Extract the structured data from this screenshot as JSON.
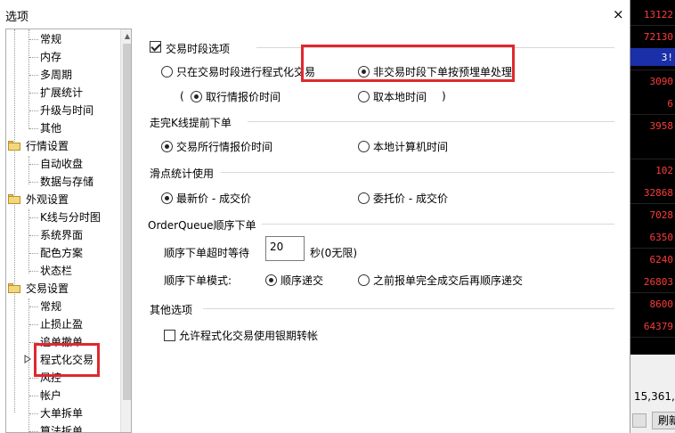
{
  "dialog": {
    "title": "选项",
    "close_label": "×"
  },
  "tree": {
    "items": [
      {
        "label": "常规",
        "type": "child"
      },
      {
        "label": "内存",
        "type": "child"
      },
      {
        "label": "多周期",
        "type": "child"
      },
      {
        "label": "扩展统计",
        "type": "child"
      },
      {
        "label": "升级与时间",
        "type": "child"
      },
      {
        "label": "其他",
        "type": "child"
      },
      {
        "label": "行情设置",
        "type": "group"
      },
      {
        "label": "自动收盘",
        "type": "child"
      },
      {
        "label": "数据与存储",
        "type": "child"
      },
      {
        "label": "外观设置",
        "type": "group"
      },
      {
        "label": "K线与分时图",
        "type": "child"
      },
      {
        "label": "系统界面",
        "type": "child"
      },
      {
        "label": "配色方案",
        "type": "child"
      },
      {
        "label": "状态栏",
        "type": "child"
      },
      {
        "label": "交易设置",
        "type": "group"
      },
      {
        "label": "常规",
        "type": "child"
      },
      {
        "label": "止损止盈",
        "type": "child"
      },
      {
        "label": "追单撤单",
        "type": "child"
      },
      {
        "label": "程式化交易",
        "type": "child",
        "selected": true
      },
      {
        "label": "风控",
        "type": "child"
      },
      {
        "label": "帐户",
        "type": "child"
      },
      {
        "label": "大单拆单",
        "type": "child"
      },
      {
        "label": "算法拆单",
        "type": "child"
      }
    ]
  },
  "sections": {
    "trading_period": {
      "checkbox_label": "交易时段选项",
      "checked": true,
      "opt_only_in_session": "只在交易时段进行程式化交易",
      "opt_non_session_preorder": "非交易时段下单按预埋单处理",
      "paren_open": "(",
      "paren_close": ")",
      "opt_quote_time": "取行情报价时间",
      "opt_local_time": "取本地时间"
    },
    "kline_early": {
      "title": "走完K线提前下单",
      "opt_exchange_time": "交易所行情报价时间",
      "opt_local_computer_time": "本地计算机时间"
    },
    "slippage": {
      "title": "滑点统计使用",
      "opt_latest_price": "最新价 - 成交价",
      "opt_order_price": "委托价 - 成交价"
    },
    "orderqueue": {
      "title": "OrderQueue顺序下单",
      "timeout_label": "顺序下单超时等待",
      "timeout_value": "20",
      "timeout_unit": "秒(0无限)",
      "mode_label": "顺序下单模式:",
      "opt_sequential": "顺序递交",
      "opt_after_prev": "之前报单完全成交后再顺序递交"
    },
    "other": {
      "title": "其他选项",
      "allow_bank_transfer": "允许程式化交易使用银期转帐"
    }
  },
  "background": {
    "numbers": [
      "13122",
      "72130",
      "3!",
      "3090",
      "6",
      "3958",
      "",
      "102",
      "32868",
      "7028",
      "6350",
      "6240",
      "26803",
      "8600",
      "64379"
    ],
    "summary": "15,361,",
    "refresh": "刷新"
  },
  "colors": {
    "highlight": "#e0282e",
    "selection_blue": "#1b2fa8",
    "number_red": "#ff3b3b"
  }
}
